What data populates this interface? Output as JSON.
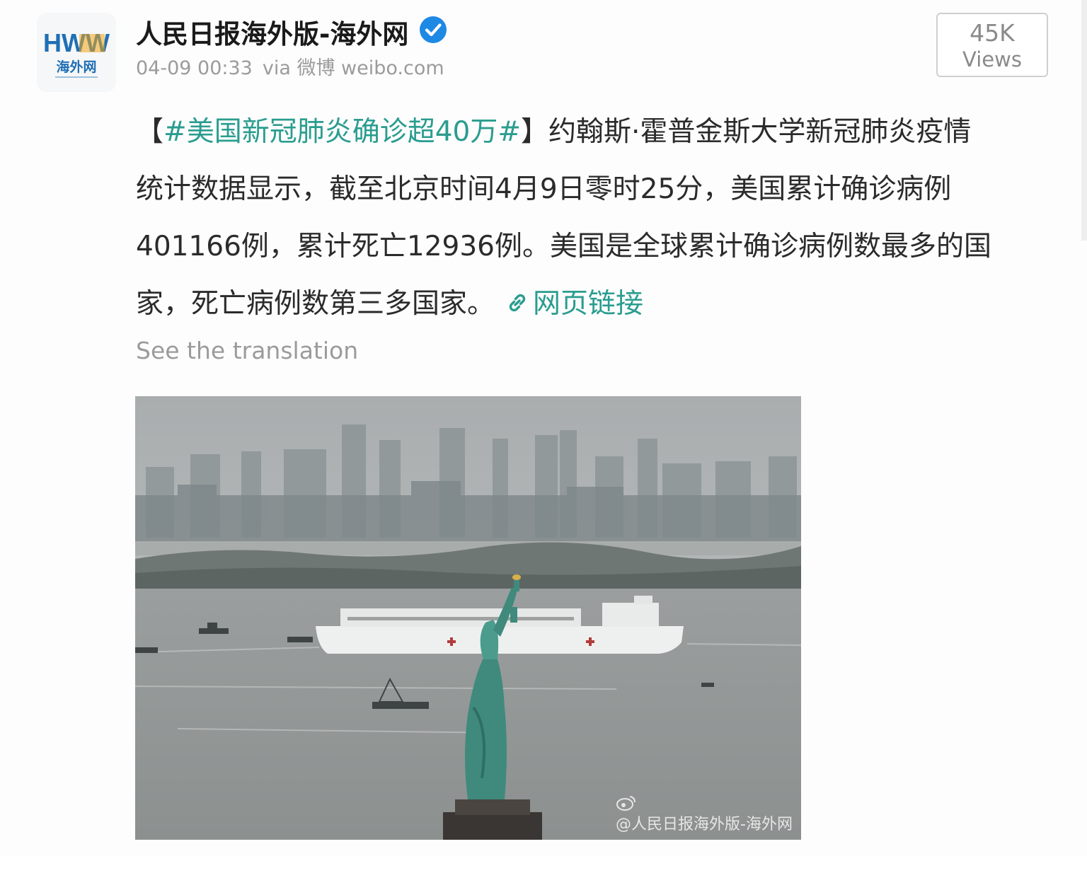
{
  "author": {
    "name": "人民日报海外版-海外网",
    "avatar_logo_text": "HWW",
    "avatar_sub_text": "海外网",
    "verified": true
  },
  "meta": {
    "timestamp": "04-09 00:33",
    "via": "via 微博 weibo.com"
  },
  "views": {
    "count": "45K",
    "label": "Views"
  },
  "post": {
    "bracket_open": "【",
    "hashtag": "#美国新冠肺炎确诊超40万#",
    "bracket_close": "】",
    "line1_rest": "约翰斯·霍普金斯大学新冠肺炎疫情",
    "line2": "统计数据显示，截至北京时间4月9日零时25分，美国累计确诊病例",
    "line3": "401166例，累计死亡12936例。美国是全球累计确诊病例数最多的国",
    "line4": "家，死亡病例数第三多国家。",
    "link_label": "网页链接",
    "translate_label": "See the translation"
  },
  "image": {
    "watermark": "@人民日报海外版-海外网"
  },
  "colors": {
    "link": "#2a9d8f",
    "verified": "#1e88e5",
    "muted": "#9b9b9b"
  },
  "icons": {
    "verified": "verified-check-icon",
    "link": "link-icon",
    "watermark": "weibo-logo-icon"
  }
}
